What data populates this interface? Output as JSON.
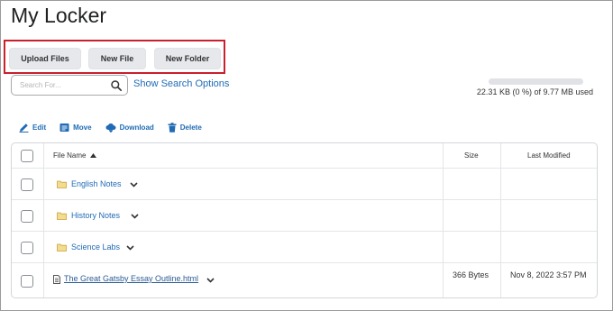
{
  "page": {
    "title": "My Locker"
  },
  "actions": {
    "upload_label": "Upload Files",
    "new_file_label": "New File",
    "new_folder_label": "New Folder"
  },
  "search": {
    "placeholder": "Search For...",
    "show_options_label": "Show Search Options",
    "icon": "search-icon"
  },
  "quota": {
    "text": "22.31 KB (0 %) of 9.77 MB used",
    "used_percent": 0
  },
  "toolbar": {
    "edit_label": "Edit",
    "move_label": "Move",
    "download_label": "Download",
    "delete_label": "Delete"
  },
  "table": {
    "headers": {
      "name": "File Name",
      "size": "Size",
      "modified": "Last Modified"
    },
    "rows": [
      {
        "type": "folder",
        "name": "English Notes",
        "size": "",
        "modified": ""
      },
      {
        "type": "folder",
        "name": "History Notes",
        "size": "",
        "modified": ""
      },
      {
        "type": "folder",
        "name": "Science Labs",
        "size": "",
        "modified": ""
      },
      {
        "type": "file",
        "name": "The Great Gatsby Essay Outline.html",
        "size": "366 Bytes",
        "modified": "Nov 8, 2022 3:57 PM"
      }
    ]
  },
  "colors": {
    "link": "#1f6bb5",
    "highlight_border": "#c8202d",
    "folder": "#e5c56a"
  }
}
